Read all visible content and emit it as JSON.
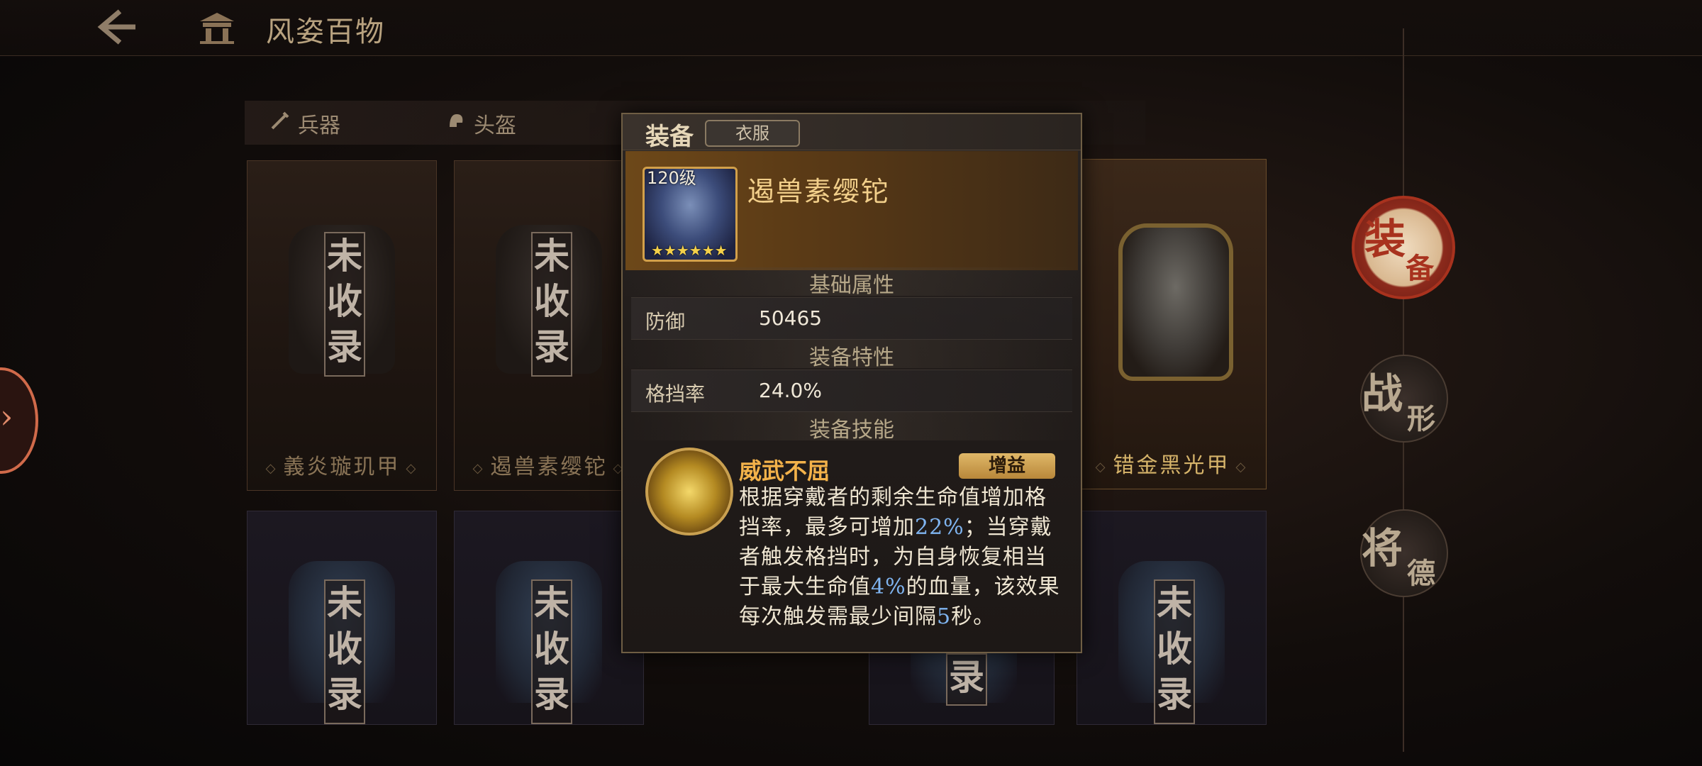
{
  "header": {
    "back_icon": "back-arrow-icon",
    "title_icon": "palace-gate-icon",
    "title": "风姿百物"
  },
  "tabs": [
    {
      "label": "兵器",
      "icon": "sword-icon"
    },
    {
      "label": "头盔",
      "icon": "helmet-icon"
    }
  ],
  "cards_row1": [
    {
      "name": "義炎璇玑甲",
      "stamp": "未收录",
      "collected": false
    },
    {
      "name": "遏兽素缨铊",
      "stamp": "未收录",
      "collected": false
    },
    {
      "name": "错金黑光甲",
      "stamp": "",
      "collected": true
    }
  ],
  "cards_row2": [
    {
      "stamp": "未收录"
    },
    {
      "stamp": "未收录"
    },
    {
      "stamp": "录"
    },
    {
      "stamp": "未收录"
    }
  ],
  "right_nav": [
    {
      "big": "装",
      "small": "备",
      "active": true
    },
    {
      "big": "战",
      "small": "形",
      "active": false
    },
    {
      "big": "将",
      "small": "德",
      "active": false
    }
  ],
  "modal": {
    "title": "装备",
    "tag": "衣服",
    "item": {
      "level": "120级",
      "stars": "★★★★★★",
      "name": "遏兽素缨铊"
    },
    "section_basic": "基础属性",
    "basic_label": "防御",
    "basic_value": "50465",
    "section_trait": "装备特性",
    "trait_label": "格挡率",
    "trait_value": "24.0%",
    "section_skill": "装备技能",
    "skill": {
      "name": "威武不屈",
      "tag": "增益",
      "desc_1": "根据穿戴者的剩余生命值增加格挡率，最多可增加",
      "hl_1": "22%",
      "desc_2": "；当穿戴者触发格挡时，为自身恢复相当于最大生命值",
      "hl_2": "4%",
      "desc_3": "的血量，该效果每次触发需最少间隔",
      "hl_3": "5",
      "desc_4": "秒。"
    }
  },
  "colors": {
    "accent_gold": "#f2cf8a",
    "highlight_blue": "#7fb4f0",
    "skill_orange": "#f3b24a",
    "nav_red": "#a8321e"
  }
}
